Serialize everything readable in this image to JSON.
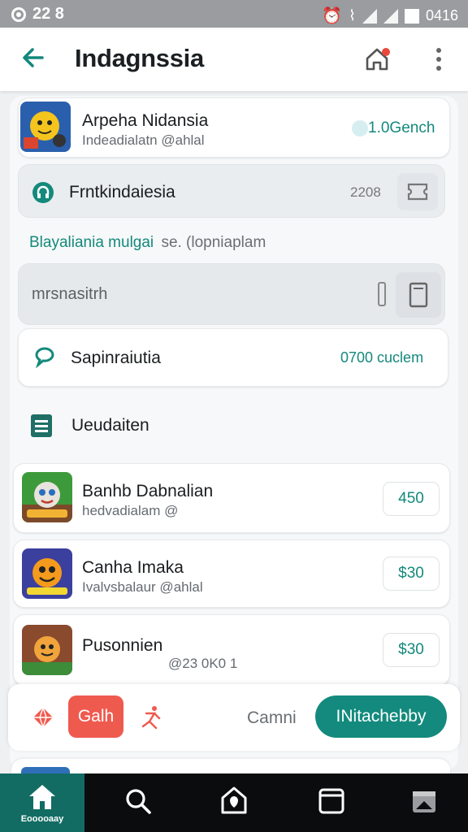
{
  "status_bar": {
    "time": "22 8",
    "clock": "0416"
  },
  "app_bar": {
    "title": "Indagnssia"
  },
  "top_item": {
    "name": "Arpeha Nidansia",
    "handle": "Indeadialatn @ahlal",
    "value": "1.0Gench"
  },
  "feature_row": {
    "label": "Frntkindaiesia",
    "value": "2208"
  },
  "section_link": "Blayaliania mulgai",
  "section_hint": "se. (lopniaplam",
  "search": {
    "placeholder": "mrsnasitrh"
  },
  "saving_row": {
    "label": "Sapinraiutia",
    "value": "0700 cuclem"
  },
  "list_header": "Ueudaiten",
  "items": [
    {
      "name": "Banhb Dabnalian",
      "handle": "hedvadialam @",
      "price": "450"
    },
    {
      "name": "Canha Imaka",
      "handle": "Ivalvsbalaur @ahlal",
      "price": "$30"
    },
    {
      "name": "Pusonnien",
      "handle": "@23 0K0 1",
      "price": "$30"
    }
  ],
  "action_bar": {
    "call_label": "Galh",
    "cancel_label": "Camni",
    "primary_label": "INitachebby"
  },
  "nav": {
    "home_label": "Eooooaay"
  },
  "colors": {
    "accent": "#138a7d",
    "danger": "#ef5a4f",
    "nav_bg": "#0b0c0d"
  }
}
